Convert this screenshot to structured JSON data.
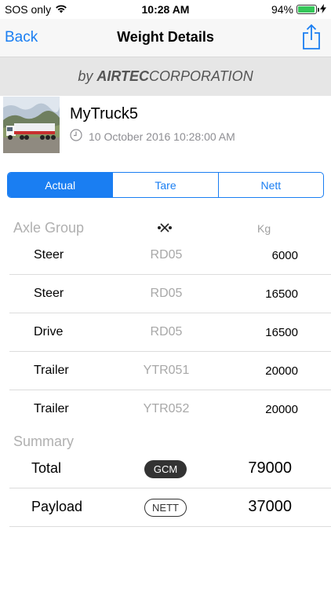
{
  "status_bar": {
    "carrier": "SOS only",
    "time": "10:28 AM",
    "battery": "94%",
    "battery_level": 0.94,
    "icons": [
      "wifi-icon",
      "battery-icon",
      "charging-bolt-icon"
    ]
  },
  "nav": {
    "back_label": "Back",
    "title": "Weight Details",
    "share_icon": "share-icon"
  },
  "brand": {
    "prefix": "by ",
    "bold": "AIRTEC",
    "rest": "CORPORATION"
  },
  "truck": {
    "name": "MyTruck5",
    "date": "10 October 2016 10:28:00 AM",
    "clock_icon": "clock-icon"
  },
  "segments": [
    {
      "label": "Actual",
      "active": true
    },
    {
      "label": "Tare",
      "active": false
    },
    {
      "label": "Nett",
      "active": false
    }
  ],
  "axle_section": {
    "header": "Axle Group",
    "group_column_icon": "axle-icon",
    "unit_header": "Kg",
    "rows": [
      {
        "name": "Steer",
        "group": "RD05",
        "kg": "6000"
      },
      {
        "name": "Steer",
        "group": "RD05",
        "kg": "16500"
      },
      {
        "name": "Drive",
        "group": "RD05",
        "kg": "16500"
      },
      {
        "name": "Trailer",
        "group": "YTR051",
        "kg": "20000"
      },
      {
        "name": "Trailer",
        "group": "YTR052",
        "kg": "20000"
      }
    ]
  },
  "summary": {
    "header": "Summary",
    "rows": [
      {
        "name": "Total",
        "badge": "GCM",
        "badge_style": "filled",
        "value": "79000"
      },
      {
        "name": "Payload",
        "badge": "NETT",
        "badge_style": "outline",
        "value": "37000"
      }
    ]
  },
  "colors": {
    "accent": "#1a7ef2",
    "battery_green": "#35c759"
  }
}
